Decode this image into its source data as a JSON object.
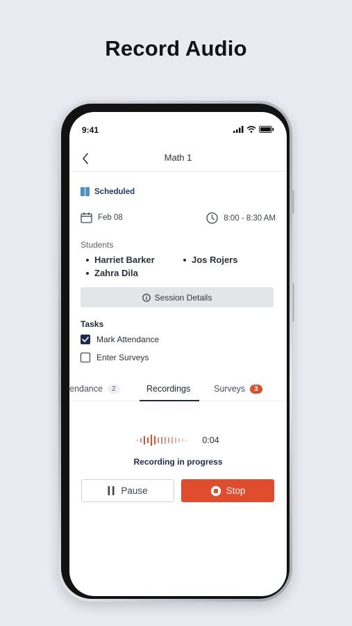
{
  "headline": "Record Audio",
  "status_bar": {
    "time": "9:41"
  },
  "nav": {
    "title": "Math 1"
  },
  "session": {
    "status": "Scheduled",
    "date": "Feb 08",
    "time_range": "8:00 - 8:30 AM",
    "students_label": "Students",
    "students": [
      "Harriet Barker",
      "Jos Rojers",
      "Zahra Dila"
    ],
    "details_button": "Session Details"
  },
  "tasks": {
    "label": "Tasks",
    "items": [
      {
        "label": "Mark Attendance",
        "checked": true
      },
      {
        "label": "Enter Surveys",
        "checked": false
      }
    ]
  },
  "tabs": [
    {
      "label": "endance",
      "badge": "2"
    },
    {
      "label": "Recordings",
      "badge": ""
    },
    {
      "label": "Surveys",
      "badge": "3"
    }
  ],
  "recording": {
    "elapsed": "0:04",
    "status": "Recording in progress",
    "pause_label": "Pause",
    "stop_label": "Stop"
  },
  "colors": {
    "accent_navy": "#1e2a52",
    "stop_red": "#e04d2c",
    "status_blue": "#4d8fd0"
  }
}
